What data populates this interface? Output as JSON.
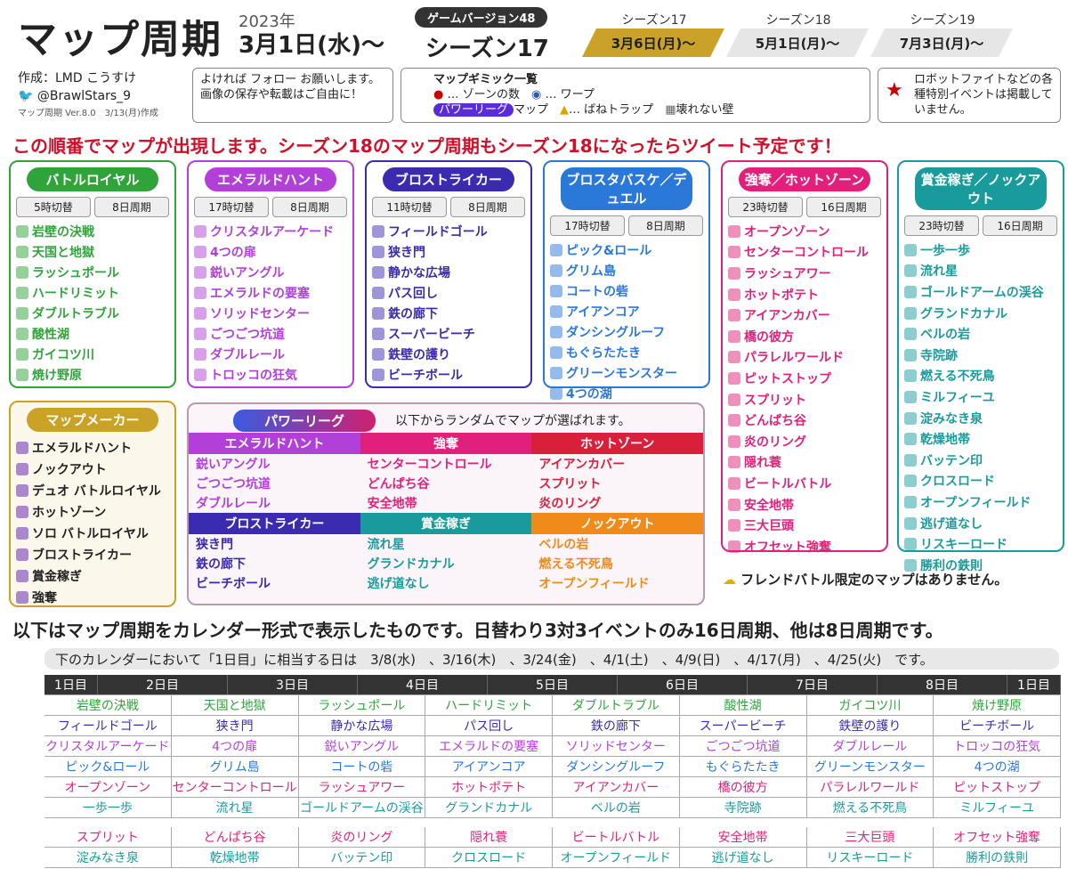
{
  "header": {
    "title": "マップ周期",
    "year": "2023年",
    "start_date": "3月1日(水)〜",
    "version_badge": "ゲームバージョン48",
    "season": "シーズン17",
    "seasons": [
      {
        "label": "シーズン17",
        "date": "3月6日(月)〜",
        "color": "#c9a227"
      },
      {
        "label": "シーズン18",
        "date": "5月1日(月)〜",
        "color": "#e6e6e6"
      },
      {
        "label": "シーズン19",
        "date": "7月3日(月)〜",
        "color": "#e6e6e6"
      }
    ]
  },
  "credit": {
    "author": "作成：LMD こうすけ",
    "twitter": "@BrawlStars_9",
    "version": "マップ周期 Ver.8.0　3/13(月)作成"
  },
  "follow_note": "よければ フォロー お願いします。画像の保存や転載はご自由に！",
  "legend": {
    "title": "マップギミック一覧",
    "zone": "… ゾーンの数",
    "warp": "… ワープ",
    "pl": "パワーリーグ",
    "pl_suffix": "マップ",
    "spring": "… ばねトラップ",
    "wall": "壊れない壁"
  },
  "event_note": "ロボットファイトなどの各種特別イベントは掲載していません。",
  "headline": "この順番でマップが出現します。シーズン18のマップ周期もシーズン18になったらツイート予定です！",
  "modes": [
    {
      "name": "バトルロイヤル",
      "color": "#2ea43a",
      "switch": "5時切替",
      "cycle": "8日周期",
      "maps": [
        "岩壁の決戦",
        "天国と地獄",
        "ラッシュポール",
        "ハードリミット",
        "ダブルトラブル",
        "酸性湖",
        "ガイコツ川",
        "焼け野原"
      ]
    },
    {
      "name": "エメラルドハント",
      "color": "#b13fd8",
      "switch": "17時切替",
      "cycle": "8日周期",
      "maps": [
        "クリスタルアーケード",
        "4つの扉",
        "鋭いアングル",
        "エメラルドの要塞",
        "ソリッドセンター",
        "ごつごつ坑道",
        "ダブルレール",
        "トロッコの狂気"
      ]
    },
    {
      "name": "ブロストライカー",
      "color": "#3a2bb0",
      "switch": "11時切替",
      "cycle": "8日周期",
      "maps": [
        "フィールドゴール",
        "狭き門",
        "静かな広場",
        "パス回し",
        "鉄の廊下",
        "スーパービーチ",
        "鉄壁の護り",
        "ビーチボール"
      ]
    },
    {
      "name": "ブロスタバスケ／デュエル",
      "color": "#2a78d8",
      "switch": "17時切替",
      "cycle": "8日周期",
      "maps": [
        "ピック&ロール",
        "グリム島",
        "コートの砦",
        "アイアンコア",
        "ダンシングルーフ",
        "もぐらたたき",
        "グリーンモンスター",
        "4つの湖"
      ]
    },
    {
      "name": "強奪／ホットゾーン",
      "color": "#e0207a",
      "switch": "23時切替",
      "cycle": "16日周期",
      "maps": [
        "オープンゾーン",
        "センターコントロール",
        "ラッシュアワー",
        "ホットポテト",
        "アイアンカバー",
        "橋の彼方",
        "パラレルワールド",
        "ピットストップ",
        "スプリット",
        "どんぱち谷",
        "炎のリング",
        "隠れ蓑",
        "ビートルバトル",
        "安全地帯",
        "三大巨頭",
        "オフセット強奪"
      ]
    },
    {
      "name": "賞金稼ぎ／ノックアウト",
      "color": "#1a9b9b",
      "switch": "23時切替",
      "cycle": "16日周期",
      "maps": [
        "一歩一歩",
        "流れ星",
        "ゴールドアームの渓谷",
        "グランドカナル",
        "ベルの岩",
        "寺院跡",
        "燃える不死鳥",
        "ミルフィーユ",
        "淀みなき泉",
        "乾燥地帯",
        "バッテン印",
        "クロスロード",
        "オープンフィールド",
        "逃げ道なし",
        "リスキーロード",
        "勝利の鉄則"
      ]
    }
  ],
  "mapmaker": {
    "name": "マップメーカー",
    "items": [
      "エメラルドハント",
      "ノックアウト",
      "デュオ バトルロイヤル",
      "ホットゾーン",
      "ソロ バトルロイヤル",
      "ブロストライカー",
      "賞金稼ぎ",
      "強奪"
    ]
  },
  "powerleague": {
    "name": "パワーリーグ",
    "note": "以下からランダムでマップが選ばれます。",
    "groups": [
      {
        "name": "エメラルドハント",
        "color": "#b13fd8",
        "maps": [
          "鋭いアングル",
          "ごつごつ坑道",
          "ダブルレール"
        ]
      },
      {
        "name": "強奪",
        "color": "#e0207a",
        "maps": [
          "センターコントロール",
          "どんぱち谷",
          "安全地帯"
        ]
      },
      {
        "name": "ホットゾーン",
        "color": "#d8203a",
        "maps": [
          "アイアンカバー",
          "スプリット",
          "炎のリング"
        ]
      },
      {
        "name": "ブロストライカー",
        "color": "#3a2bb0",
        "maps": [
          "狭き門",
          "鉄の廊下",
          "ビーチボール"
        ]
      },
      {
        "name": "賞金稼ぎ",
        "color": "#1a9b9b",
        "maps": [
          "流れ星",
          "グランドカナル",
          "逃げ道なし"
        ]
      },
      {
        "name": "ノックアウト",
        "color": "#f08a1a",
        "maps": [
          "ベルの岩",
          "燃える不死鳥",
          "オープンフィールド"
        ]
      }
    ]
  },
  "friend_note": "フレンドバトル限定のマップはありません。",
  "calendar": {
    "intro": "以下はマップ周期をカレンダー形式で表示したものです。日替わり3対3イベントのみ16日周期、他は8日周期です。",
    "note": "下のカレンダーにおいて「1日目」に相当する日は　3/8(水)　、3/16(木)　、3/24(金)　、4/1(土)　、4/9(日)　、4/17(月)　、4/25(火)　です。",
    "days": [
      "1日目",
      "2日目",
      "3日目",
      "4日目",
      "5日目",
      "6日目",
      "7日目",
      "8日目",
      "1日目"
    ]
  }
}
